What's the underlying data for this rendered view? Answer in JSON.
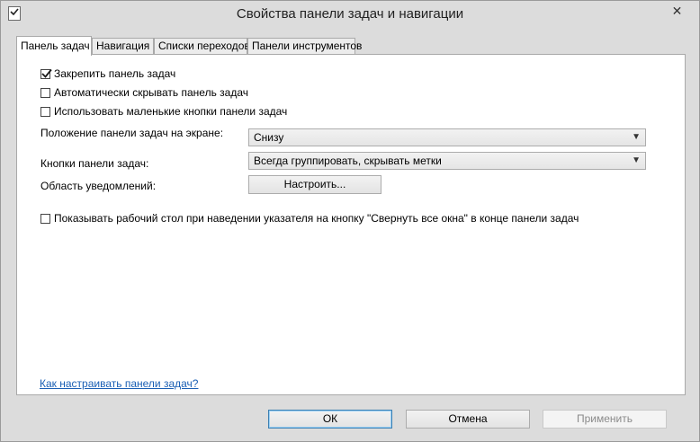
{
  "window": {
    "title": "Свойства панели задач и навигации",
    "close_glyph": "✕"
  },
  "tabs": [
    {
      "label": "Панель задач",
      "active": true
    },
    {
      "label": "Навигация",
      "active": false
    },
    {
      "label": "Списки переходов",
      "active": false
    },
    {
      "label": "Панели инструментов",
      "active": false
    }
  ],
  "taskbar": {
    "lock": {
      "label": "Закрепить панель задач",
      "checked": true
    },
    "autohide": {
      "label": "Автоматически скрывать панель задач",
      "checked": false
    },
    "small_buttons": {
      "label": "Использовать маленькие кнопки панели задач",
      "checked": false
    },
    "position_label": "Положение панели задач на экране:",
    "position_value": "Снизу",
    "buttons_label": "Кнопки панели задач:",
    "buttons_value": "Всегда группировать, скрывать метки",
    "notification_label": "Область уведомлений:",
    "customize_button": "Настроить...",
    "peek": {
      "label": "Показывать рабочий стол при наведении указателя на кнопку \"Свернуть все окна\" в конце панели задач",
      "checked": false
    },
    "help_link": "Как настраивать панели задач?"
  },
  "footer": {
    "ok": "ОК",
    "cancel": "Отмена",
    "apply": "Применить"
  },
  "icons": {
    "app": "taskbar-properties-icon",
    "dropdown": "chevron-down-icon",
    "check": "checkmark-icon"
  }
}
